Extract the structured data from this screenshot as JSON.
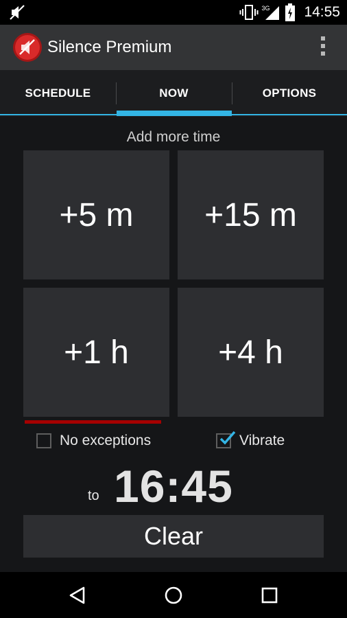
{
  "status_bar": {
    "network_type": "3G",
    "time": "14:55",
    "icons": [
      "mute-icon",
      "vibrate-icon",
      "signal-icon",
      "battery-icon"
    ]
  },
  "app_bar": {
    "title": "Silence Premium",
    "icons": [
      "app-mute-icon",
      "overflow-menu-icon"
    ]
  },
  "tabs": [
    {
      "label": "SCHEDULE",
      "selected": false
    },
    {
      "label": "NOW",
      "selected": true
    },
    {
      "label": "OPTIONS",
      "selected": false
    }
  ],
  "main": {
    "section_label": "Add more time",
    "buttons": [
      {
        "label": "+5 m"
      },
      {
        "label": "+15 m"
      },
      {
        "label": "+1 h"
      },
      {
        "label": "+4 h"
      }
    ],
    "progress_fraction": 1.0,
    "checkboxes": {
      "no_exceptions": {
        "label": "No exceptions",
        "checked": false
      },
      "vibrate": {
        "label": "Vibrate",
        "checked": true
      }
    },
    "to_label": "to",
    "end_time": "16:45",
    "clear_label": "Clear"
  },
  "nav_bar": {
    "icons": [
      "back-icon",
      "home-icon",
      "recents-icon"
    ]
  },
  "colors": {
    "accent": "#33b5e5",
    "progress": "#a50000",
    "app_icon": "#d92a2a",
    "tile": "#2d2e31"
  }
}
